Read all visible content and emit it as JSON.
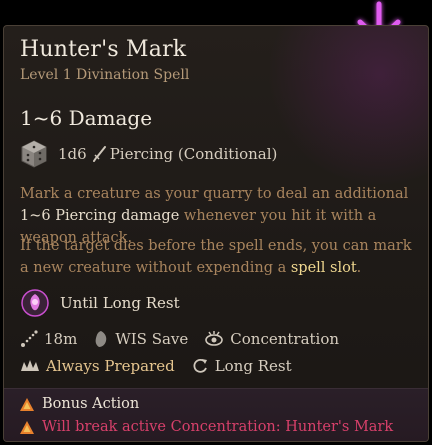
{
  "spell": {
    "name": "Hunter's Mark",
    "subtitle": "Level 1 Divination Spell",
    "damage_heading": "1~6 Damage",
    "dice": "1d6",
    "damage_type": "Piercing (Conditional)"
  },
  "description": {
    "p1_a": "Mark a creature as your quarry to deal an additional ",
    "p1_b": "1~6",
    "p1_c": " ",
    "p1_d": "Piercing damage",
    "p1_e": " whenever you hit it with a weapon attack.",
    "p2_a": "If the target dies before the spell ends, you can mark a new creature without expending a ",
    "p2_b": "spell slot",
    "p2_c": "."
  },
  "duration": "Until Long Rest",
  "meta": {
    "range": "18m",
    "save": "WIS Save",
    "concentration": "Concentration",
    "prepared": "Always Prepared",
    "recharge": "Long Rest"
  },
  "footer": {
    "action_type": "Bonus Action",
    "warning": "Will break active Concentration: Hunter's Mark"
  },
  "colors": {
    "skull_glow": "#e05cf0",
    "warning": "#d7406a",
    "footer_icon": "#e8802c"
  },
  "icons": [
    "skull-icon",
    "die-icon",
    "dagger-icon",
    "rune-icon",
    "range-icon",
    "save-icon",
    "concentration-icon",
    "prepared-icon",
    "recharge-icon",
    "bonus-action-icon",
    "warning-icon"
  ]
}
